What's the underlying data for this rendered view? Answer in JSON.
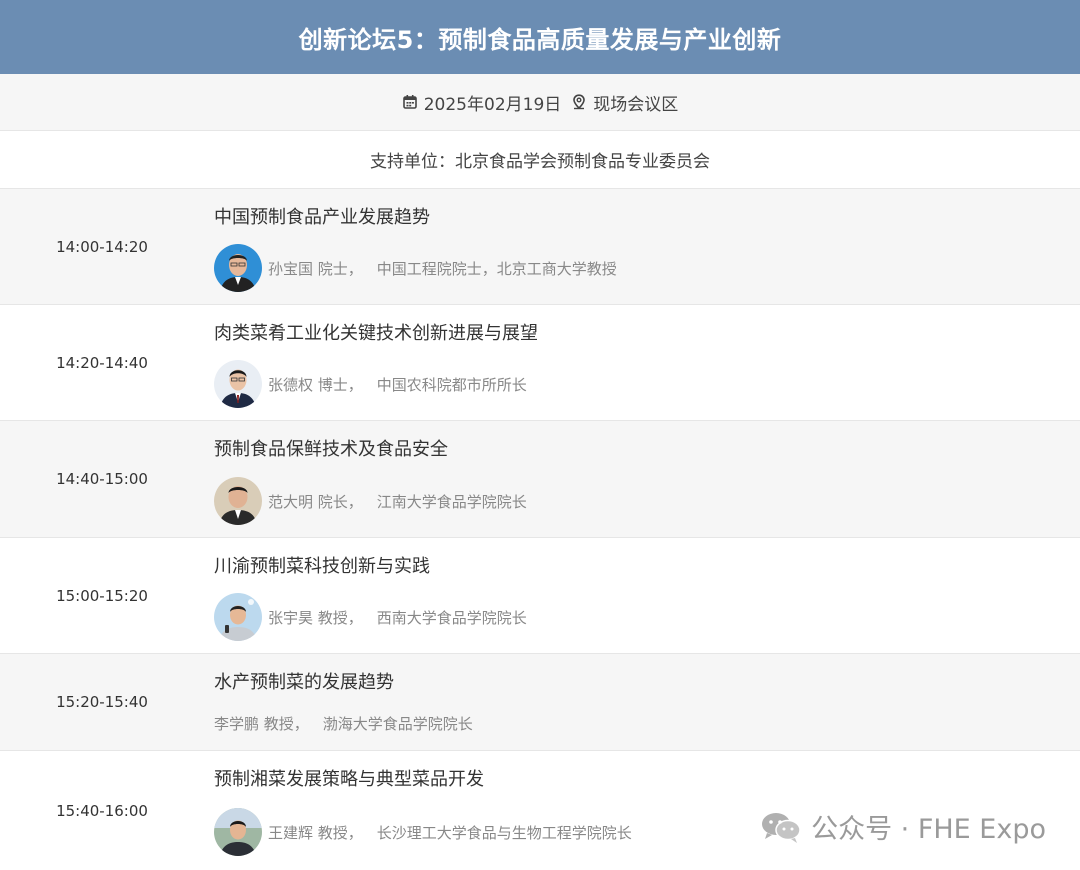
{
  "header": {
    "title": "创新论坛5：预制食品高质量发展与产业创新"
  },
  "info": {
    "date_icon": "calendar-icon",
    "date": "2025年02月19日",
    "location_icon": "location-pin-icon",
    "location": "现场会议区"
  },
  "support": {
    "text": "支持单位：北京食品学会预制食品专业委员会"
  },
  "agenda": [
    {
      "time": "14:00-14:20",
      "title": "中国预制食品产业发展趋势",
      "speaker": "孙宝国 院士，",
      "org": "中国工程院院士，北京工商大学教授",
      "has_avatar": true
    },
    {
      "time": "14:20-14:40",
      "title": "肉类菜肴工业化关键技术创新进展与展望",
      "speaker": "张德权 博士，",
      "org": "中国农科院都市所所长",
      "has_avatar": true
    },
    {
      "time": "14:40-15:00",
      "title": "预制食品保鲜技术及食品安全",
      "speaker": "范大明 院长，",
      "org": "江南大学食品学院院长",
      "has_avatar": true
    },
    {
      "time": "15:00-15:20",
      "title": "川渝预制菜科技创新与实践",
      "speaker": "张宇昊 教授，",
      "org": "西南大学食品学院院长",
      "has_avatar": true
    },
    {
      "time": "15:20-15:40",
      "title": "水产预制菜的发展趋势",
      "speaker": "李学鹏 教授，",
      "org": "渤海大学食品学院院长",
      "has_avatar": false
    },
    {
      "time": "15:40-16:00",
      "title": "预制湘菜发展策略与典型菜品开发",
      "speaker": "王建辉 教授，",
      "org": "长沙理工大学食品与生物工程学院院长",
      "has_avatar": true
    }
  ],
  "watermark": {
    "icon": "wechat-icon",
    "text": "公众号 · FHE Expo"
  }
}
